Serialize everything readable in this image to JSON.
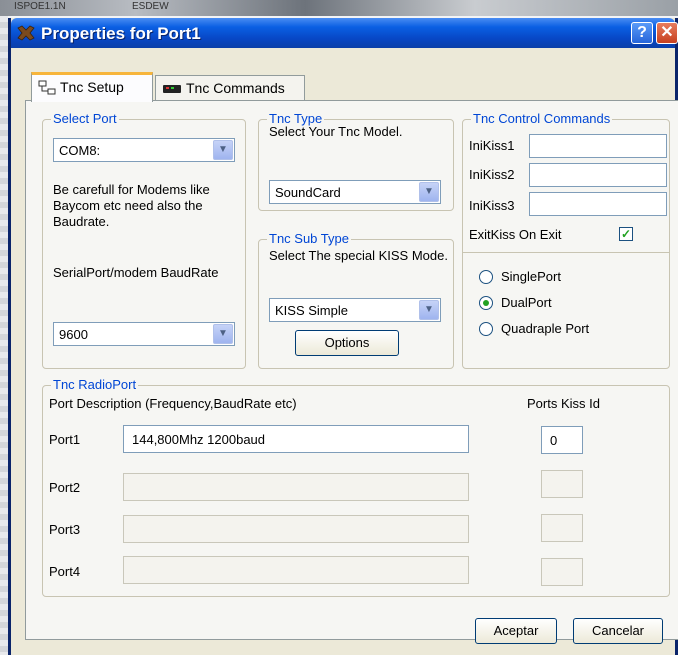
{
  "background": {
    "left_text": "ISPOE1.1N",
    "right_text": "ESDEW"
  },
  "window": {
    "title": "Properties for Port1",
    "help_label": "?",
    "close_label": "✕",
    "title_color": "#0a5fe3"
  },
  "tabs": [
    {
      "label": "Tnc Setup",
      "icon": "network-icon",
      "active": true
    },
    {
      "label": "Tnc Commands",
      "icon": "tnc-device-icon",
      "active": false
    }
  ],
  "select_port": {
    "title": "Select Port",
    "value": "COM8:",
    "note": "Be carefull for Modems like Baycom etc need also the Baudrate.",
    "baud_label": "SerialPort/modem BaudRate",
    "baud_value": "9600"
  },
  "tnc_type": {
    "title": "Tnc Type",
    "caption": "Select Your Tnc Model.",
    "value": "SoundCard"
  },
  "tnc_sub_type": {
    "title": "Tnc Sub Type",
    "caption": "Select The special KISS Mode.",
    "value": "KISS Simple",
    "options_label": "Options"
  },
  "tnc_control": {
    "title": "Tnc Control Commands",
    "fields": [
      {
        "label": "IniKiss1",
        "value": ""
      },
      {
        "label": "IniKiss2",
        "value": ""
      },
      {
        "label": "IniKiss3",
        "value": ""
      }
    ],
    "exit_label": "ExitKiss On Exit",
    "exit_checked": true,
    "ports_mode": [
      {
        "label": "SinglePort",
        "checked": false
      },
      {
        "label": "DualPort",
        "checked": true
      },
      {
        "label": "Quadraple Port",
        "checked": false
      }
    ]
  },
  "radio_port": {
    "title": "Tnc RadioPort",
    "desc_header": "Port Description (Frequency,BaudRate etc)",
    "kiss_header": "Ports Kiss Id",
    "ports": [
      {
        "label": "Port1",
        "description": "144,800Mhz 1200baud",
        "kiss_id": "0",
        "enabled": true
      },
      {
        "label": "Port2",
        "description": "",
        "kiss_id": "",
        "enabled": false
      },
      {
        "label": "Port3",
        "description": "",
        "kiss_id": "",
        "enabled": false
      },
      {
        "label": "Port4",
        "description": "",
        "kiss_id": "",
        "enabled": false
      }
    ]
  },
  "buttons": {
    "ok_label": "Aceptar",
    "cancel_label": "Cancelar"
  }
}
